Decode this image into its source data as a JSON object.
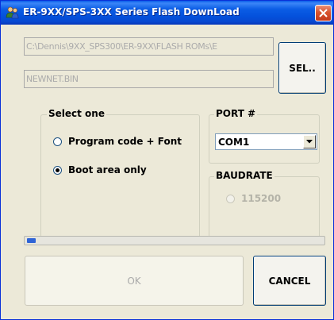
{
  "window": {
    "title": "ER-9XX/SPS-3XX Series Flash DownLoad"
  },
  "fields": {
    "path": "C:\\Dennis\\9XX_SPS300\\ER-9XX\\FLASH ROMs\\E",
    "filename": "NEWNET.BIN"
  },
  "buttons": {
    "select_label": "SEL..",
    "ok_label": "OK",
    "cancel_label": "CANCEL"
  },
  "select_group": {
    "label": "Select one",
    "options": [
      {
        "label": "Program code + Font",
        "checked": false
      },
      {
        "label": "Boot area only",
        "checked": true
      }
    ]
  },
  "port_group": {
    "label": "PORT #",
    "selected": "COM1"
  },
  "baud_group": {
    "label": "BAUDRATE",
    "option": "115200",
    "enabled": false
  },
  "progress": {
    "fraction": 0.03
  },
  "colors": {
    "title_bar": "#0a5ce8",
    "close_button": "#d9542f",
    "progress_fill": "#2f64d6",
    "dialog_bg": "#ece9d8"
  },
  "icons": {
    "app": "app-people-icon",
    "close": "close-icon",
    "dropdown": "chevron-down-icon"
  }
}
